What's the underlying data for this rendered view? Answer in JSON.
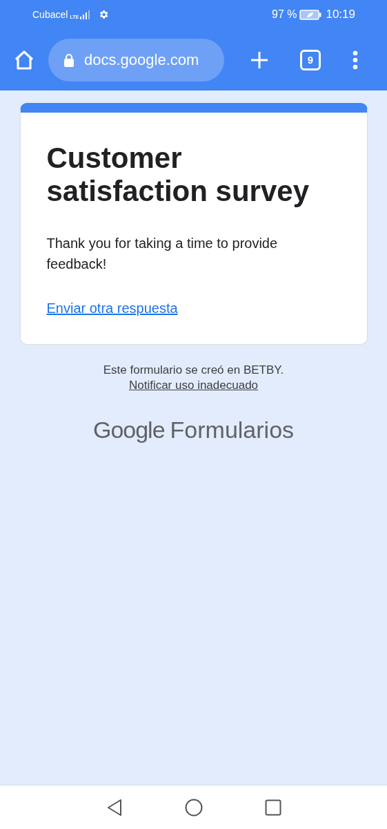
{
  "status_bar": {
    "carrier": "Cubacel",
    "network": "LTE",
    "battery": "97 %",
    "time": "10:19"
  },
  "browser_toolbar": {
    "url": "docs.google.com",
    "tab_count": "9"
  },
  "form_card": {
    "title": "Customer satisfaction survey",
    "message": "Thank you for taking a time to provide feedback!",
    "link": "Enviar otra respuesta"
  },
  "footer": {
    "text": "Este formulario se creó en BETBY.",
    "link": "Notificar uso inadecuado",
    "logo_google": "Google",
    "logo_product": "Formularios"
  }
}
